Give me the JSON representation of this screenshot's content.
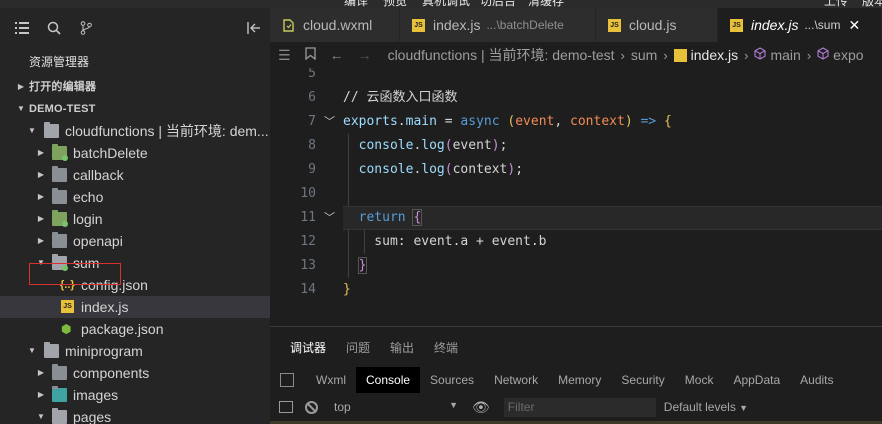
{
  "menubar": {
    "items": [
      "编译",
      "预览",
      "真机调试",
      "切后台",
      "清缓存",
      "上传",
      "版本"
    ]
  },
  "sidebar": {
    "icons": [
      "list-icon",
      "search-icon",
      "source-control-icon",
      "split-icon"
    ],
    "explorer_title": "资源管理器",
    "open_editors": "打开的编辑器",
    "project": "DEMO-TEST",
    "tree": [
      {
        "label": "cloudfunctions | 当前环境: dem...",
        "kind": "folder-cloud",
        "indent": 1,
        "expanded": true
      },
      {
        "label": "batchDelete",
        "kind": "folder-cloud",
        "indent": 2,
        "expanded": false
      },
      {
        "label": "callback",
        "kind": "folder",
        "indent": 2,
        "expanded": false
      },
      {
        "label": "echo",
        "kind": "folder",
        "indent": 2,
        "expanded": false
      },
      {
        "label": "login",
        "kind": "folder-cloud",
        "indent": 2,
        "expanded": false
      },
      {
        "label": "openapi",
        "kind": "folder",
        "indent": 2,
        "expanded": false
      },
      {
        "label": "sum",
        "kind": "folder-cloud",
        "indent": 2,
        "expanded": true
      },
      {
        "label": "config.json",
        "kind": "json",
        "indent": 3
      },
      {
        "label": "index.js",
        "kind": "js",
        "indent": 3,
        "selected": true
      },
      {
        "label": "package.json",
        "kind": "pkg",
        "indent": 3
      },
      {
        "label": "miniprogram",
        "kind": "folder",
        "indent": 1,
        "expanded": true
      },
      {
        "label": "components",
        "kind": "folder",
        "indent": 2,
        "expanded": false
      },
      {
        "label": "images",
        "kind": "folder-img",
        "indent": 2,
        "expanded": false
      },
      {
        "label": "pages",
        "kind": "folder",
        "indent": 2,
        "expanded": false
      }
    ]
  },
  "tabs": [
    {
      "name": "cloud.wxml",
      "desc": "",
      "icon": "wxml"
    },
    {
      "name": "index.js",
      "desc": "...\\batchDelete",
      "icon": "js"
    },
    {
      "name": "cloud.js",
      "desc": "",
      "icon": "js"
    },
    {
      "name": "index.js",
      "desc": "...\\sum",
      "icon": "js",
      "active": true,
      "close": "✕"
    }
  ],
  "breadcrumb": {
    "parts": [
      "cloudfunctions | 当前环境: demo-test",
      "sum",
      "index.js",
      "main",
      "expo"
    ]
  },
  "editor": {
    "lines": [
      {
        "num": "5"
      },
      {
        "num": "6"
      },
      {
        "num": "7"
      },
      {
        "num": "8"
      },
      {
        "num": "9"
      },
      {
        "num": "10"
      },
      {
        "num": "11"
      },
      {
        "num": "12"
      },
      {
        "num": "13"
      },
      {
        "num": "14"
      }
    ],
    "comment": "// 云函数入口函数"
  },
  "panel": {
    "tabs": [
      "调试器",
      "问题",
      "输出",
      "终端"
    ],
    "devtools": [
      "Wxml",
      "Console",
      "Sources",
      "Network",
      "Memory",
      "Security",
      "Mock",
      "AppData",
      "Audits"
    ],
    "context": "top",
    "filter_placeholder": "Filter",
    "levels": "Default levels"
  },
  "colors": {
    "accent_red": "#d8312e",
    "js_yellow": "#e8c13b",
    "cloud_green": "#7ea35f"
  }
}
